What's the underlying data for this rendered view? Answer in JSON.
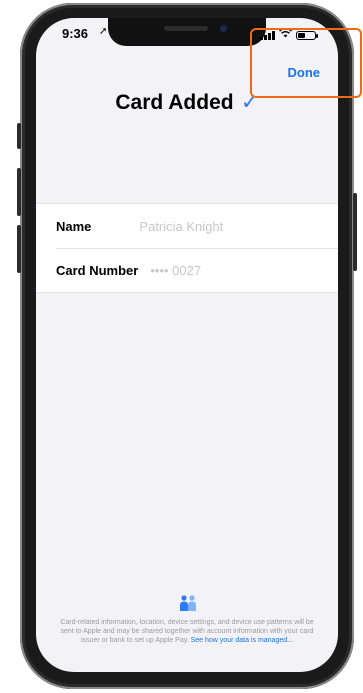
{
  "status_bar": {
    "time": "9:36",
    "location_arrow": "➚",
    "battery_level": 0.45
  },
  "header": {
    "done_label": "Done",
    "title": "Card Added",
    "check_icon": "check-icon"
  },
  "card": {
    "rows": [
      {
        "label": "Name",
        "value": "Patricia Knight"
      },
      {
        "label": "Card Number",
        "value": "•••• 0027"
      }
    ]
  },
  "footer": {
    "text": "Card-related information, location, device settings, and device use patterns will be sent to Apple and may be shared together with account information with your card issuer or bank to set up Apple Pay.",
    "link": "See how your data is managed..."
  },
  "colors": {
    "accent": "#1a73e8",
    "highlight": "#ef6a18",
    "check": "#2f7bf6"
  }
}
